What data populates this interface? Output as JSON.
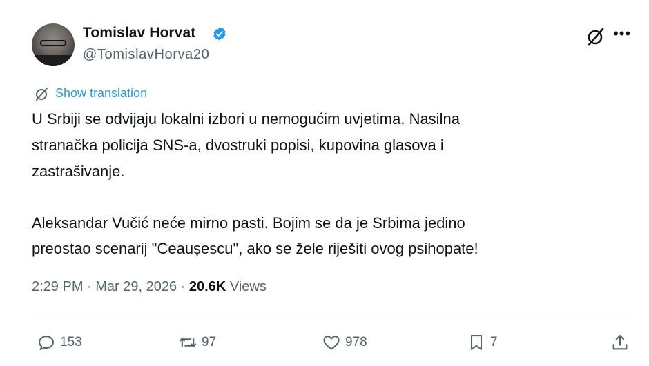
{
  "author": {
    "display_name": "Tomislav Horvat",
    "handle": "@TomislavHorva20"
  },
  "show_translation": "Show translation",
  "tweet_lines": [
    "U Srbiji se odvijaju lokalni izbori u nemogućim uvjetima. Nasilna",
    "stranačka policija SNS-a, dvostruki popisi, kupovina glasova i",
    "zastrašivanje.",
    "Aleksandar Vučić neće mirno pasti. Bojim se da je Srbima jedino",
    "preostao scenarij \"Ceaușescu\", ako se žele riješiti ovog psihopate!"
  ],
  "meta": {
    "time": "2:29 PM",
    "separator": " · ",
    "date": "Mar 29, 2026",
    "views_count": "20.6K",
    "views_label": " Views"
  },
  "actions": {
    "replies": "153",
    "retweets": "97",
    "likes": "978",
    "bookmarks": "7"
  },
  "icons": {
    "verified": "verified-badge-icon",
    "grok": "grok-icon",
    "more": "more-icon",
    "translate": "translate-icon",
    "reply": "reply-icon",
    "retweet": "retweet-icon",
    "like": "heart-icon",
    "bookmark": "bookmark-icon",
    "share": "share-icon"
  },
  "colors": {
    "accent": "#1d9bf0",
    "secondary_text": "#536471",
    "primary_text": "#0f1419"
  }
}
